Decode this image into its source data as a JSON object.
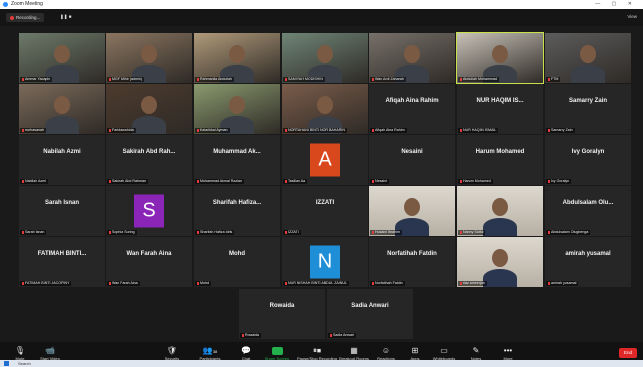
{
  "window": {
    "title": "Zoom Meeting"
  },
  "top": {
    "recording": "Recording...",
    "view": "View"
  },
  "participants": [
    {
      "label": "Ammar Yacapin",
      "big": "",
      "type": "video"
    },
    {
      "label": "MGF Mihir (admin)",
      "big": "",
      "type": "video"
    },
    {
      "label": "Rahmanila Abdullah",
      "big": "",
      "type": "video"
    },
    {
      "label": "SAMIYAH MODISHIN",
      "big": "",
      "type": "video"
    },
    {
      "label": "Wan Ardi Zaharah",
      "big": "",
      "type": "video"
    },
    {
      "label": "Abdullah Mohammad",
      "big": "",
      "type": "video"
    },
    {
      "label": "FTM",
      "big": "",
      "type": "video"
    },
    {
      "label": "nurhasanah",
      "big": "",
      "type": "video"
    },
    {
      "label": "Faridawahida",
      "big": "",
      "type": "video"
    },
    {
      "label": "Kalarikkal Ayman",
      "big": "",
      "type": "video"
    },
    {
      "label": "NORTAHANI BINTI NOR BAHARIN",
      "big": "",
      "type": "video"
    },
    {
      "label": "Afiqah Aina Rahim",
      "big": "Afiqah Aina Rahim",
      "type": "name"
    },
    {
      "label": "NUR HAQIM ISMAIL",
      "big": "NUR HAQIM IS...",
      "type": "name"
    },
    {
      "label": "Samarry Zain",
      "big": "Samarry Zain",
      "type": "name"
    },
    {
      "label": "Nabilah Azmi",
      "big": "Nabilah Azmi",
      "type": "name"
    },
    {
      "label": "Sakirah Abd Rahman",
      "big": "Sakirah Abd Rah...",
      "type": "name"
    },
    {
      "label": "Muhammad Akmal Razlan",
      "big": "Muhammad Ak...",
      "type": "name"
    },
    {
      "label": "Taslilan Aa",
      "big": "",
      "type": "avatar",
      "letter": "A",
      "color": "#d9481c"
    },
    {
      "label": "Nesaini",
      "big": "Nesaini",
      "type": "name"
    },
    {
      "label": "Harum Mohamed",
      "big": "Harum Mohamed",
      "type": "name"
    },
    {
      "label": "Ivy Goralyn",
      "big": "Ivy Goralyn",
      "type": "name"
    },
    {
      "label": "Sarah Isnan",
      "big": "Sarah Isnan",
      "type": "name"
    },
    {
      "label": "Sophia Suring",
      "big": "",
      "type": "avatar",
      "letter": "S",
      "color": "#8a25b8"
    },
    {
      "label": "Sharifah Hafiza Idris",
      "big": "Sharifah Hafiza...",
      "type": "name"
    },
    {
      "label": "IZZATI",
      "big": "IZZATI",
      "type": "name"
    },
    {
      "label": "Husaini Ibrahim",
      "big": "",
      "type": "photo"
    },
    {
      "label": "Nanny Saiful",
      "big": "",
      "type": "photo"
    },
    {
      "label": "Abdulsalam Olugbenga",
      "big": "Abdulsalam Olu...",
      "type": "name"
    },
    {
      "label": "FATIMAH BINTI JACOPINY",
      "big": "FATIMAH BINTI...",
      "type": "name"
    },
    {
      "label": "Wan Farah Aina",
      "big": "Wan Farah Aina",
      "type": "name"
    },
    {
      "label": "Mohd",
      "big": "Mohd",
      "type": "name"
    },
    {
      "label": "NUR NISHAH BINTI ABDUL ZAINUL",
      "big": "",
      "type": "avatar",
      "letter": "N",
      "color": "#1e8fd6"
    },
    {
      "label": "Norfatihah Fatdin",
      "big": "Norfatihah Fatdin",
      "type": "name"
    },
    {
      "label": "riaz ameerjan",
      "big": "",
      "type": "photo"
    },
    {
      "label": "amirah yusamal",
      "big": "amirah yusamal",
      "type": "name"
    },
    {
      "label": "Rowaida",
      "big": "Rowaida",
      "type": "name"
    },
    {
      "label": "Sadia Anwari",
      "big": "Sadia Anwari",
      "type": "name"
    }
  ],
  "toolbar": {
    "mute": "Mute",
    "stop_video": "Start Video",
    "security": "Security",
    "participants": "Participants",
    "participants_count": "38",
    "chat": "Chat",
    "share": "Share Screen",
    "pause_recording": "Pause/Stop Recording",
    "breakout": "Breakout Rooms",
    "reactions": "Reactions",
    "apps": "Apps",
    "whiteboards": "Whiteboards",
    "notes": "Notes",
    "more": "More",
    "end": "End"
  },
  "taskbar": {
    "search": "Search"
  }
}
